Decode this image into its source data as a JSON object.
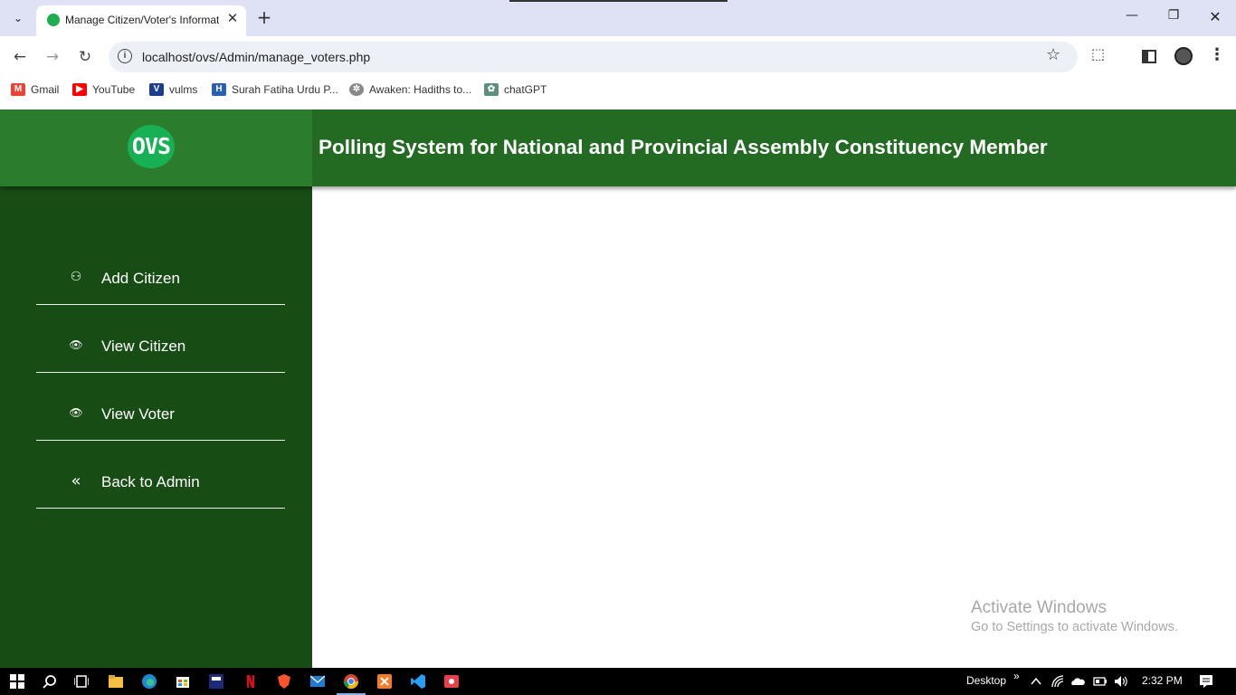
{
  "browser": {
    "tab_title": "Manage Citizen/Voter's Information",
    "tab_close": "✕",
    "new_tab": "+",
    "tab_list": "⌄",
    "window_min": "—",
    "window_max": "❐",
    "window_close": "✕",
    "back": "←",
    "forward": "→",
    "reload": "↻",
    "url": "localhost/ovs/Admin/manage_voters.php",
    "star": "☆",
    "extensions": "⬚",
    "menu": "⋮",
    "info": "i"
  },
  "bookmarks": [
    {
      "label": "Gmail",
      "icon": "gmail-icon",
      "color": "#ea4335"
    },
    {
      "label": "YouTube",
      "icon": "youtube-icon",
      "color": "#ff0000"
    },
    {
      "label": "vulms",
      "icon": "vulms-icon",
      "color": "#1a3d8f"
    },
    {
      "label": "Surah Fatiha Urdu P...",
      "icon": "quran-icon",
      "color": "#2b5fb3"
    },
    {
      "label": "Awaken: Hadiths to...",
      "icon": "awaken-icon",
      "color": "#888888"
    },
    {
      "label": "chatGPT",
      "icon": "chatgpt-icon",
      "color": "#5e8f7e"
    }
  ],
  "header": {
    "logo_text": "OVS",
    "title": "Polling System for National and Provincial Assembly Constituency Member"
  },
  "sidebar": {
    "items": [
      {
        "label": "Add Citizen",
        "icon": "add-user-icon",
        "glyph": "⚇"
      },
      {
        "label": "View Citizen",
        "icon": "eye-icon",
        "glyph": "👁"
      },
      {
        "label": "View Voter",
        "icon": "eye-icon",
        "glyph": "👁"
      },
      {
        "label": "Back to Admin",
        "icon": "double-chevron-left-icon",
        "glyph": "«"
      }
    ]
  },
  "watermark": {
    "title": "Activate Windows",
    "subtitle": "Go to Settings to activate Windows."
  },
  "taskbar": {
    "desktop_label": "Desktop",
    "chevron": "»",
    "time": "2:32 PM"
  },
  "colors": {
    "header_green": "#236b22",
    "sidebar_green": "#174d15",
    "logo_green": "#17b055"
  }
}
